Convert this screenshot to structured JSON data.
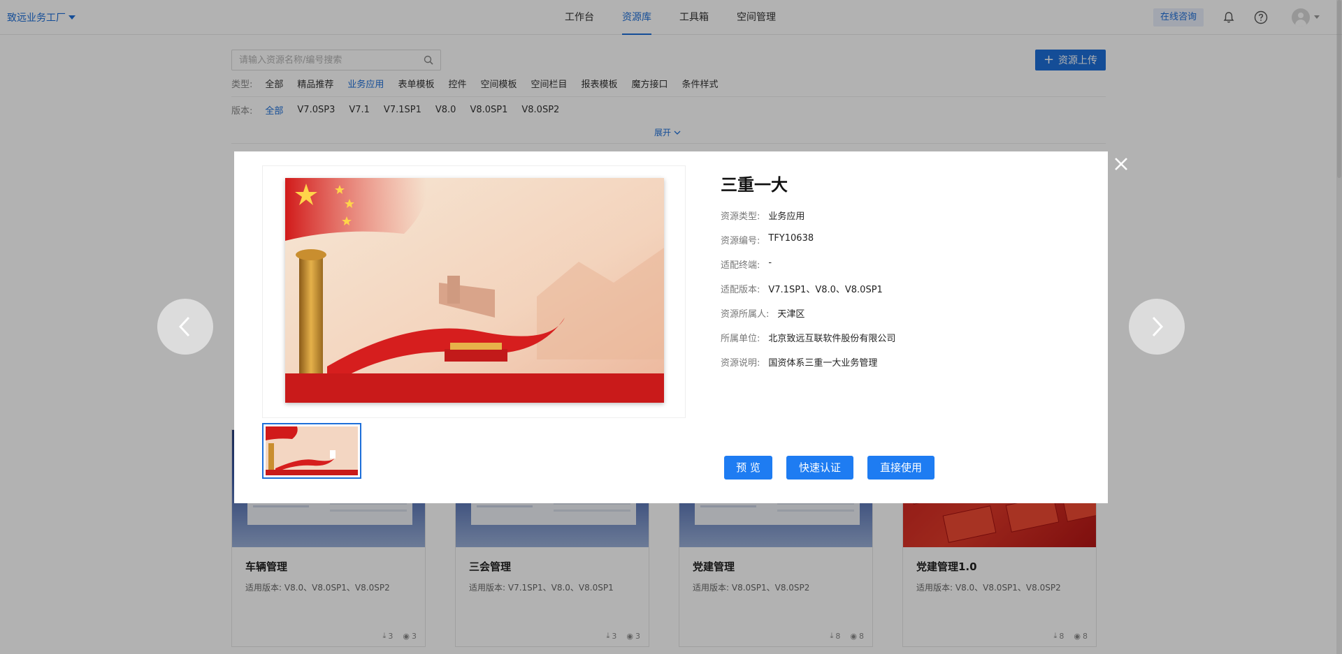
{
  "topbar": {
    "brand": "致远业务工厂",
    "nav": [
      "工作台",
      "资源库",
      "工具箱",
      "空间管理"
    ],
    "active_nav": 1,
    "consult": "在线咨询"
  },
  "search": {
    "placeholder": "请输入资源名称/编号搜索"
  },
  "upload_button": "资源上传",
  "type_filter": {
    "label": "类型:",
    "items": [
      "全部",
      "精品推荐",
      "业务应用",
      "表单模板",
      "控件",
      "空间模板",
      "空间栏目",
      "报表模板",
      "魔方接口",
      "条件样式"
    ],
    "active": 2
  },
  "version_filter": {
    "label": "版本:",
    "items": [
      "全部",
      "V7.0SP3",
      "V7.1",
      "V7.1SP1",
      "V8.0",
      "V8.0SP1",
      "V8.0SP2"
    ],
    "active": 0
  },
  "expand_label": "展开",
  "cards": [
    {
      "title": "车辆管理",
      "meta": "适用版本:  V8.0、V8.0SP1、V8.0SP2",
      "downloads": "3",
      "views": "3",
      "thumb": "screenshot"
    },
    {
      "title": "三会管理",
      "meta": "适用版本:  V7.1SP1、V8.0、V8.0SP1",
      "downloads": "3",
      "views": "3",
      "thumb": "screenshot"
    },
    {
      "title": "党建管理",
      "meta": "适用版本:  V8.0SP1、V8.0SP2",
      "downloads": "8",
      "views": "8",
      "thumb": "screenshot"
    },
    {
      "title": "党建管理1.0",
      "meta": "适用版本:  V8.0、V8.0SP1、V8.0SP2",
      "downloads": "8",
      "views": "8",
      "thumb": "red-poster"
    }
  ],
  "modal": {
    "title": "三重一大",
    "attributes": [
      {
        "key": "资源类型:",
        "value": "业务应用"
      },
      {
        "key": "资源编号:",
        "value": "TFY10638"
      },
      {
        "key": "适配终端:",
        "value": "-"
      },
      {
        "key": "适配版本:",
        "value": "V7.1SP1、V8.0、V8.0SP1"
      },
      {
        "key": "资源所属人:",
        "value": "天津区"
      },
      {
        "key": "所属单位:",
        "value": "北京致远互联软件股份有限公司"
      },
      {
        "key": "资源说明:",
        "value": "国资体系三重一大业务管理"
      }
    ],
    "buttons": {
      "preview": "预 览",
      "quick_auth": "快速认证",
      "use_directly": "直接使用"
    }
  },
  "colors": {
    "accent": "#1e6fd9",
    "modal_button": "#1e7cf2",
    "overlay": "rgba(0,0,0,0.3)"
  },
  "icons": [
    "caret-down-icon",
    "bell-icon",
    "help-icon",
    "user-icon",
    "search-icon",
    "plus-icon",
    "chevron-down-icon",
    "download-icon",
    "eye-icon",
    "close-icon",
    "chevron-left-icon",
    "chevron-right-icon"
  ]
}
